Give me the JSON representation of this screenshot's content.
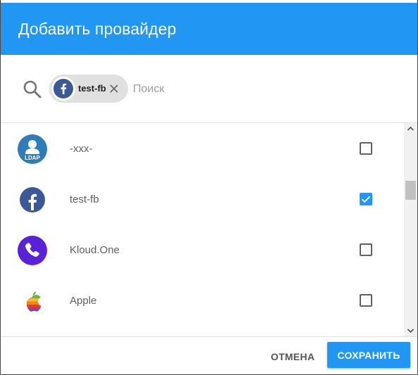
{
  "dialog": {
    "title": "Добавить провайдер"
  },
  "search": {
    "placeholder": "Поиск",
    "value": "",
    "chips": [
      {
        "label": "test-fb",
        "icon": "facebook-icon"
      }
    ]
  },
  "providers": [
    {
      "name": "-xxx-",
      "icon": "ldap-icon",
      "icon_text": "LDAP",
      "checked": false
    },
    {
      "name": "test-fb",
      "icon": "facebook-icon",
      "checked": true
    },
    {
      "name": "Kloud.One",
      "icon": "phone-icon",
      "checked": false
    },
    {
      "name": "Apple",
      "icon": "apple-icon",
      "checked": false
    }
  ],
  "actions": {
    "cancel_label": "ОТМЕНА",
    "save_label": "СОХРАНИТЬ"
  },
  "colors": {
    "accent": "#2196f3",
    "facebook": "#3b5998",
    "ldap": "#2e7db8",
    "kloud": "#5b21d6"
  }
}
